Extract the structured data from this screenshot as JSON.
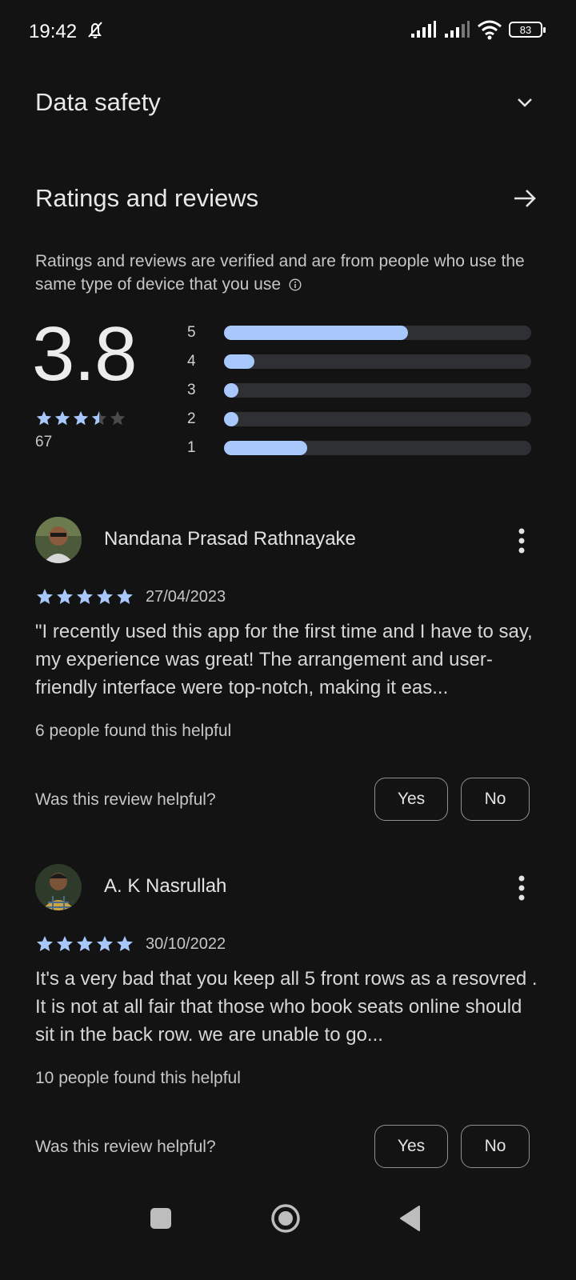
{
  "status_bar": {
    "time": "19:42",
    "battery": "83",
    "icons": [
      "alarm-off-icon",
      "signal-icon",
      "signal-icon",
      "wifi-icon",
      "battery-icon"
    ]
  },
  "data_safety": {
    "title": "Data safety",
    "icon": "chevron-down-icon"
  },
  "ratings": {
    "title": "Ratings and reviews",
    "icon": "arrow-right-icon",
    "verified_text": "Ratings and reviews are verified and are from people who use the same type of device that you use",
    "average": "3.8",
    "stars_value": 3.5,
    "count": "67",
    "distribution": [
      {
        "stars": "5",
        "fraction": 0.6
      },
      {
        "stars": "4",
        "fraction": 0.1
      },
      {
        "stars": "3",
        "fraction": 0.02
      },
      {
        "stars": "2",
        "fraction": 0.02
      },
      {
        "stars": "1",
        "fraction": 0.27
      }
    ]
  },
  "reviews": [
    {
      "name": "Nandana Prasad Rathnayake",
      "stars": 5,
      "date": "27/04/2023",
      "text": "\"I recently used this app for the first time and I have to say, my experience was great! The arrangement and user-friendly interface were top-notch, making it eas...",
      "helpful_count": "6 people found this helpful",
      "helpful_question": "Was this review helpful?",
      "yes_label": "Yes",
      "no_label": "No"
    },
    {
      "name": "A. K Nasrullah",
      "stars": 5,
      "date": "30/10/2022",
      "text": "It's a very bad that you keep all 5 front rows as a resovred . It is not at all fair that those who book seats online should sit in the back row. we are unable to go...",
      "helpful_count": "10 people found this helpful",
      "helpful_question": "Was this review helpful?",
      "yes_label": "Yes",
      "no_label": "No"
    }
  ],
  "colors": {
    "background": "#131313",
    "accent": "#a8c7fa",
    "track": "#2f3033",
    "text_primary": "#e3e3e3",
    "text_secondary": "#c6c6c6"
  },
  "nav_bar": {
    "icons": [
      "recents-square-icon",
      "home-circle-icon",
      "back-triangle-icon"
    ]
  }
}
